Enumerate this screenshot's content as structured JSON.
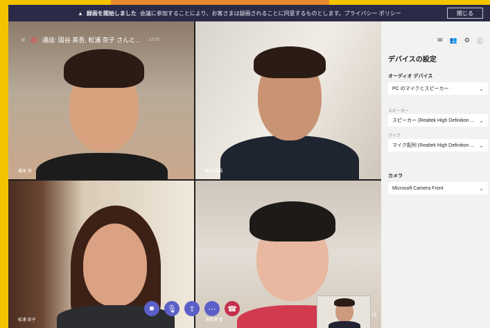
{
  "notice": {
    "icon": "warning-triangle",
    "bold": "録画を開始しました",
    "text": "会議に参加することにより、お客さまは録画されることに同意するものとします。プライバシー ポリシー",
    "close": "閉じる"
  },
  "call": {
    "title": "通話: 国谷 英吾, 松浦 奈子 さんと...",
    "time": "17:03"
  },
  "participants": [
    {
      "name": "橋本 淳"
    },
    {
      "name": "国谷 英吾"
    },
    {
      "name": "松浦 奈子"
    },
    {
      "name": "海老澤 愛"
    }
  ],
  "controls": [
    "camera",
    "microphone",
    "share",
    "more",
    "hang-up"
  ],
  "panel": {
    "title": "デバイスの設定",
    "audio_section": "オーディオ デバイス",
    "audio_value": "PC のマイクとスピーカー",
    "speaker_label": "スピーカー",
    "speaker_value": "スピーカー (Realtek High Definition ...",
    "mic_label": "マイク",
    "mic_value": "マイク配列 (Realtek High Definition ...",
    "camera_section": "カメラ",
    "camera_value": "Microsoft Camera Front"
  },
  "colors": {
    "accent": "#5b5fc7",
    "hangup": "#c4314b",
    "frame": "#f5c400",
    "notice_bg": "#2b2b48"
  }
}
